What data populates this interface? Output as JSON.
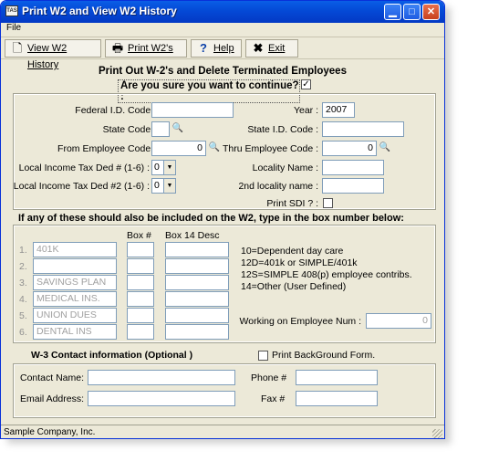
{
  "window": {
    "title": "Print W2 and View W2 History",
    "icon_text": "TAS"
  },
  "menu": {
    "file": "File"
  },
  "toolbar": {
    "view_history": "View W2 History",
    "print": "Print W2's",
    "help": "Help",
    "exit": "Exit"
  },
  "headings": {
    "main": "Print Out W-2's and Delete Terminated Employees",
    "confirm": "Are you sure you want to continue? :",
    "confirm_checked": true
  },
  "form": {
    "federal_id_label": "Federal I.D. Code :",
    "federal_id_value": "",
    "year_label": "Year :",
    "year_value": "2007",
    "state_code_label": "State Code :",
    "state_code_value": "",
    "state_id_label": "State I.D. Code :",
    "state_id_value": "",
    "from_emp_label": "From Employee Code :",
    "from_emp_value": "0",
    "thru_emp_label": "Thru Employee Code :",
    "thru_emp_value": "0",
    "local_tax1_label": "Local Income Tax Ded # (1-6) :",
    "local_tax1_value": "0",
    "locality_name_label": "Locality Name :",
    "locality_name_value": "",
    "local_tax2_label": "Local Income Tax Ded #2 (1-6) :",
    "local_tax2_value": "0",
    "locality2_label": "2nd locality name :",
    "locality2_value": "",
    "print_sdi_label": "Print SDI ? :",
    "print_sdi_checked": false
  },
  "box_section": {
    "heading": "If any of these should also be included on the W2, type in the box number below:",
    "box_col": "Box #",
    "desc_col": "Box 14 Desc",
    "rows": [
      {
        "num": "1.",
        "name": "401K",
        "box": "",
        "desc": ""
      },
      {
        "num": "2.",
        "name": "",
        "box": "",
        "desc": ""
      },
      {
        "num": "3.",
        "name": "SAVINGS PLAN",
        "box": "",
        "desc": ""
      },
      {
        "num": "4.",
        "name": "MEDICAL INS.",
        "box": "",
        "desc": ""
      },
      {
        "num": "5.",
        "name": "UNION DUES",
        "box": "",
        "desc": ""
      },
      {
        "num": "6.",
        "name": "DENTAL INS",
        "box": "",
        "desc": ""
      }
    ],
    "legend": [
      "10=Dependent day care",
      "12D=401k or SIMPLE/401k",
      "12S=SIMPLE 408(p) employee contribs.",
      "14=Other (User Defined)"
    ],
    "working_label": "Working on Employee Num :",
    "working_value": "0"
  },
  "contact": {
    "heading": "W-3 Contact information (Optional )",
    "bg_form_label": "Print BackGround Form.",
    "bg_form_checked": false,
    "name_label": "Contact Name:",
    "name_value": "",
    "phone_label": "Phone #",
    "phone_value": "",
    "email_label": "Email Address:",
    "email_value": "",
    "fax_label": "Fax #",
    "fax_value": ""
  },
  "status": {
    "text": "Sample Company, Inc."
  }
}
